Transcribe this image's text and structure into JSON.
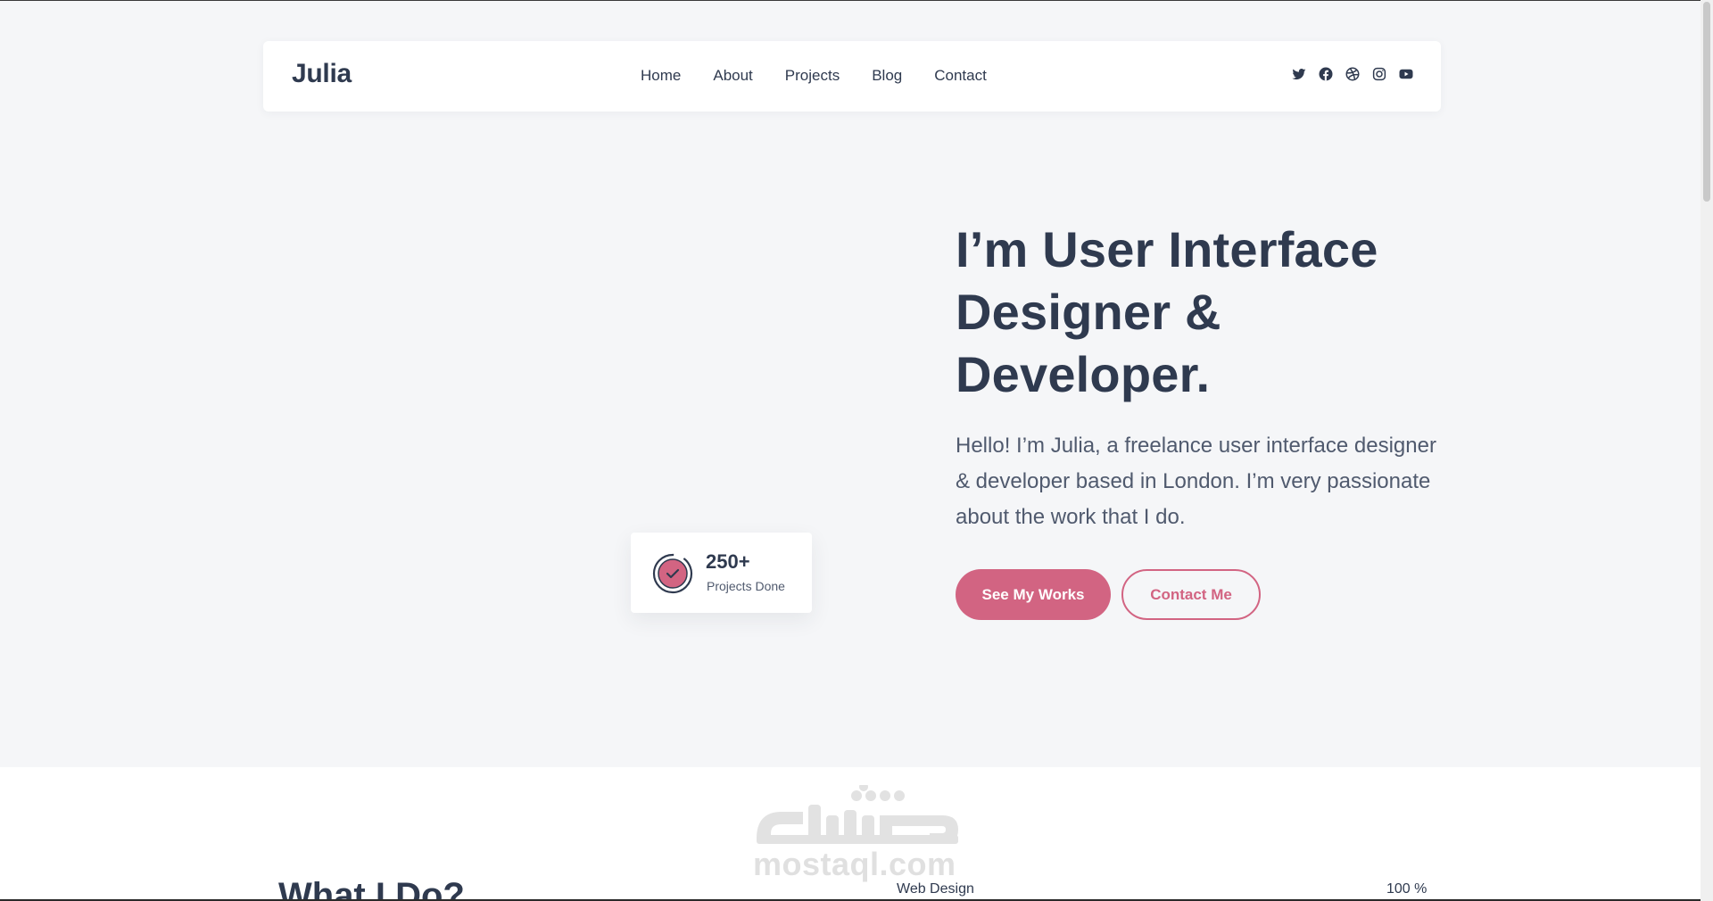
{
  "nav": {
    "logo": "Julia",
    "links": [
      "Home",
      "About",
      "Projects",
      "Blog",
      "Contact"
    ],
    "social_icons": [
      "twitter-icon",
      "facebook-icon",
      "dribbble-icon",
      "instagram-icon",
      "youtube-icon"
    ]
  },
  "hero": {
    "title_lines": [
      "I’m User Interface",
      "Designer &",
      "Developer."
    ],
    "description": "Hello! I’m Julia, a freelance user interface designer & developer based in London. I’m very passionate about the work that I do.",
    "primary_button": "See My Works",
    "secondary_button": "Contact Me"
  },
  "stat": {
    "number": "250+",
    "label": "Projects Done",
    "icon": "check-circle-icon"
  },
  "services": {
    "title": "What I Do?",
    "skills": [
      {
        "name": "Web Design",
        "percent": "100 %"
      }
    ]
  },
  "watermark": {
    "arabic": "مستقل",
    "text": "mostaql.com"
  },
  "colors": {
    "accent": "#d26482",
    "text": "#2f3a4f",
    "background": "#f5f6f8"
  }
}
